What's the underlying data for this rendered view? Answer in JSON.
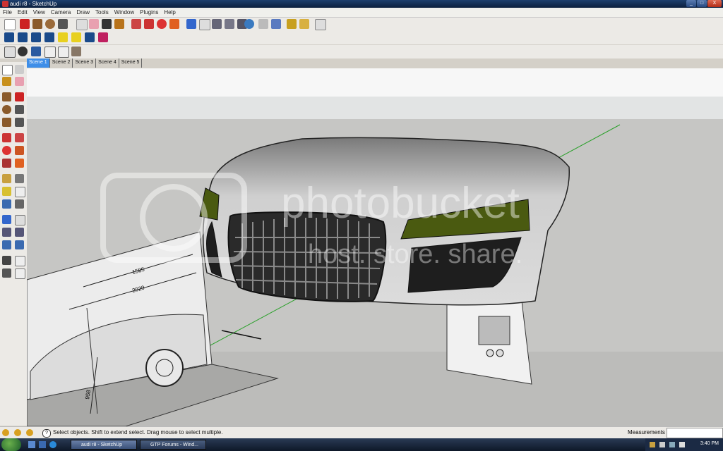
{
  "window": {
    "title": "audi r8 - SketchUp",
    "buttons": [
      "_",
      "□",
      "X"
    ]
  },
  "menu": [
    "File",
    "Edit",
    "View",
    "Camera",
    "Draw",
    "Tools",
    "Window",
    "Plugins",
    "Help"
  ],
  "scenes": [
    "Scene 1",
    "Scene 2",
    "Scene 3",
    "Scene 4",
    "Scene 5"
  ],
  "active_scene": "Scene 1",
  "drawing": {
    "dim_1": "1585",
    "dim_2": "2029",
    "dim_3": "958"
  },
  "watermark": "photobucket",
  "watermark_sub": "host. store. share.",
  "status": {
    "text": "Select objects. Shift to extend select. Drag mouse to select multiple.",
    "measurements_label": "Measurements"
  },
  "taskbar": {
    "items": [
      "audi r8 - SketchUp",
      "GTP Forums - Wind..."
    ],
    "clock": "3:40 PM"
  },
  "colors": {
    "headlight": "#4a5a10",
    "body": "#c8c8c8",
    "grille": "#2a2a2a"
  }
}
